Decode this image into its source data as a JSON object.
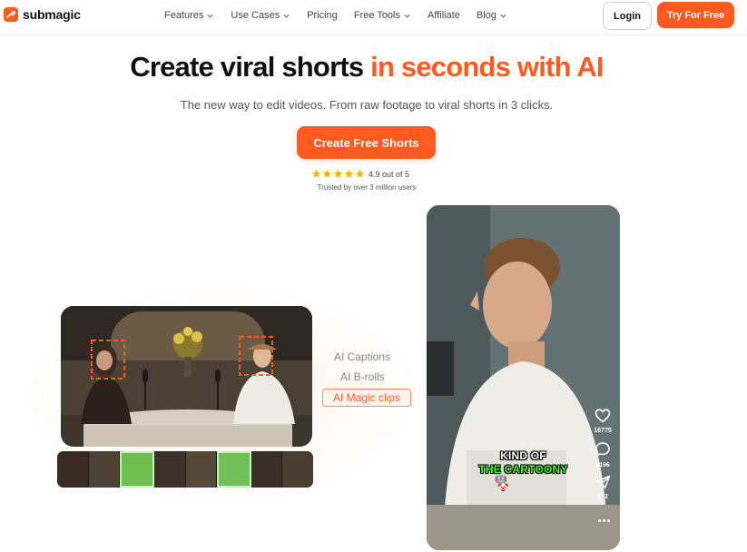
{
  "nav": {
    "logo_text": "submagic",
    "menu": [
      {
        "label": "Features",
        "dropdown": true
      },
      {
        "label": "Use Cases",
        "dropdown": true
      },
      {
        "label": "Pricing",
        "dropdown": false
      },
      {
        "label": "Free Tools",
        "dropdown": true
      },
      {
        "label": "Affiliate",
        "dropdown": false
      },
      {
        "label": "Blog",
        "dropdown": true
      }
    ],
    "login_label": "Login",
    "try_label": "Try For Free"
  },
  "hero": {
    "title_main": "Create viral shorts",
    "title_accent": "in seconds with AI",
    "subtitle": "The new way to edit videos. From raw footage to viral shorts in 3 clicks.",
    "cta_label": "Create Free Shorts",
    "rating": 4.9,
    "rating_text": "4.9 out of 5",
    "trusted_text": "Trusted by over 3 million users"
  },
  "features": {
    "items": [
      "AI Captions",
      "AI B-rolls",
      "AI Magic clips"
    ],
    "active_index": 2
  },
  "phone": {
    "likes": "16775",
    "comments": "2196",
    "shares": "752",
    "caption_line1": "KIND OF",
    "caption_line2": "THE CARTOONY"
  },
  "colors": {
    "accent": "#ff5a1f",
    "caption_green": "#3dff2a"
  },
  "icons": [
    "logo-icon",
    "chevron-down-icon",
    "star-icon",
    "heart-icon",
    "comment-icon",
    "share-icon",
    "more-icon"
  ]
}
